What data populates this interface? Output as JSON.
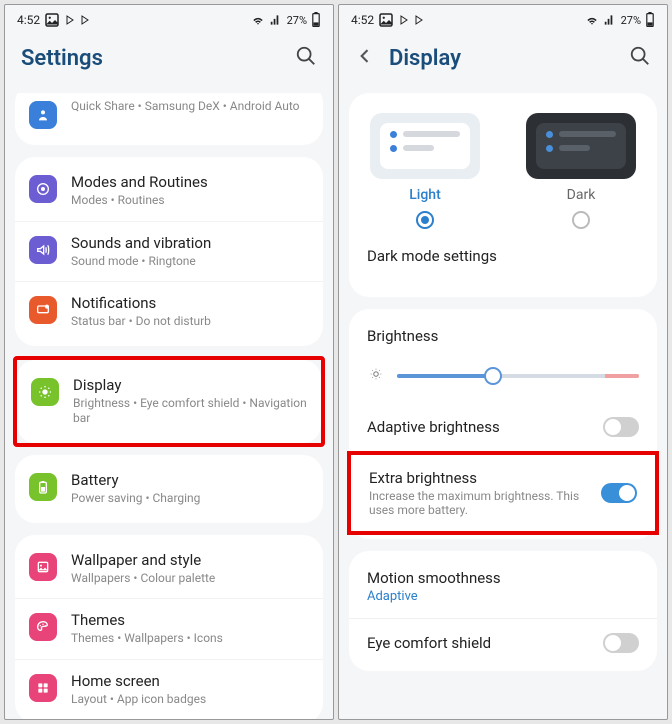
{
  "status": {
    "time": "4:52",
    "battery": "27%"
  },
  "left": {
    "title": "Settings",
    "partial": {
      "title": "",
      "sub": "Quick Share  •  Samsung DeX  •  Android Auto"
    },
    "group1": [
      {
        "title": "Modes and Routines",
        "sub": "Modes  •  Routines",
        "icon_bg": "#6d5dd3",
        "icon": "modes"
      },
      {
        "title": "Sounds and vibration",
        "sub": "Sound mode  •  Ringtone",
        "icon_bg": "#6d5dd3",
        "icon": "sound"
      },
      {
        "title": "Notifications",
        "sub": "Status bar  •  Do not disturb",
        "icon_bg": "#e85a2c",
        "icon": "notif"
      }
    ],
    "display": {
      "title": "Display",
      "sub": "Brightness  •  Eye comfort shield  •  Navigation bar",
      "icon_bg": "#78c22b",
      "icon": "display"
    },
    "battery": {
      "title": "Battery",
      "sub": "Power saving  •  Charging",
      "icon_bg": "#78c22b",
      "icon": "battery"
    },
    "group2": [
      {
        "title": "Wallpaper and style",
        "sub": "Wallpapers  •  Colour palette",
        "icon_bg": "#e8447a",
        "icon": "wallpaper"
      },
      {
        "title": "Themes",
        "sub": "Themes  •  Wallpapers  •  Icons",
        "icon_bg": "#e8447a",
        "icon": "themes"
      },
      {
        "title": "Home screen",
        "sub": "Layout  •  App icon badges",
        "icon_bg": "#e8447a",
        "icon": "home"
      }
    ]
  },
  "right": {
    "title": "Display",
    "theme": {
      "light": "Light",
      "dark": "Dark"
    },
    "dark_mode": "Dark mode settings",
    "brightness_label": "Brightness",
    "adaptive": "Adaptive brightness",
    "extra": {
      "title": "Extra brightness",
      "sub": "Increase the maximum brightness. This uses more battery."
    },
    "motion": {
      "title": "Motion smoothness",
      "value": "Adaptive"
    },
    "eye": "Eye comfort shield"
  }
}
